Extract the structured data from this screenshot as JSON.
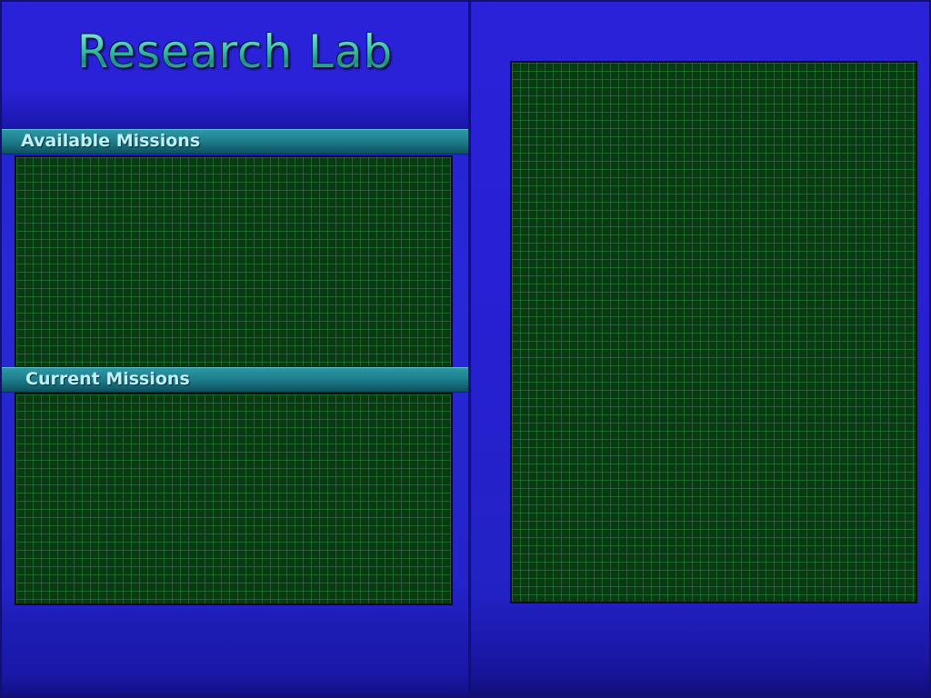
{
  "title": "Research Lab",
  "sections": {
    "available": {
      "label": "Available Missions"
    },
    "current": {
      "label": "Current Missions"
    }
  }
}
